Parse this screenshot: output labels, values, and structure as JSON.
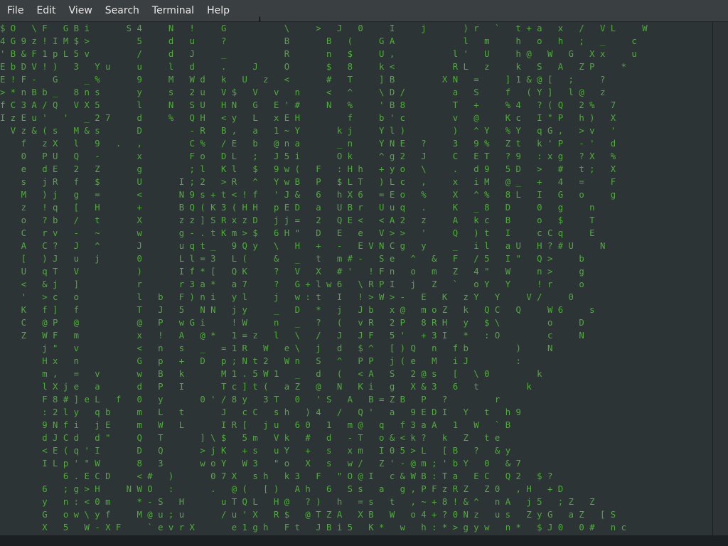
{
  "menubar": {
    "items": [
      "File",
      "Edit",
      "View",
      "Search",
      "Terminal",
      "Help"
    ]
  },
  "terminal": {
    "rows": [
      "$ O   \\ F   G B i       S 4     N   !     G           \\     >   J   0     I     j       ) r   `   t + a   x   /   V L     W",
      "4 G 9 z ! I M $ >         5     d   u     ?           B       B   (     G A             l   m     h   o   h   ;   _     c",
      "' B & F 1 p L 5 v         /     d   J     _           R       n   $     U ,           l '   U     h @   W   G   X x     u",
      "E b D V ! )   3   Y u     u     l   d     .     J     O       $   8     k <           R L   z     k   S   A   Z P     *",
      "E ! F -   G     _ %       9     M   W d   k   U   z   <       #   T     ] B         X N   =     ] 1 & @ [   ;     ?",
      "> * n B b _   8 n s       y     s   2 u   V $   V   v   n     <   ^     \\ D /         a   S     f   ( Y ]   l @   z",
      "f C 3 A / Q   V X 5       l     N   S U   H N   G   E ' #     N   %     ' B 8         T   +     % 4   ? ( Q   2 %   7",
      "I z E u '   '   _ 2 7     d     %   Q H   < y   L   x E H         f     b ' c         v   @     K c   I \" P   h )   X",
      "  V z & ( s   M & s       D         - R   B ,   a   1 ~ Y       k j     Y l )         )   ^ Y   % Y   q G ,   > v   '",
      "    f   z X   l   9   .   ,         C %   / E   b   @ n a       _ n     Y N E   ?     3   9 %   Z t   k ' P   - '   d",
      "    0   P U   Q   -       x         F o   D L   ;   J 5 i       O k     ^ g 2   J     C   E T   ? 9   : x g   ? X   %",
      "    e   d E   2   Z       g         ; l   K l   $   9 w (   F   : H h   + y o   \\     .   d 9   5 D   >   #   t ;   X",
      "    s   j R   f   $       U       I ; 2   > R   ^   Y w B   P   $ L T   ) L c   ,     x   i M   @ _   +   4   =     F",
      "    M   ) j   g   =       <       N 9 s + t < ! f   ' J &   6   h X 6   = E o   %     X   ^ %   8 L   I   G   o     g",
      "    z   ! q   [   H       +       B Q ( K 3 ( H H   p E D   a   U B r   U u q   .     K   _ 8   D     0   g     n",
      "    o   ? b   /   t       X       z z ] S R x z D   j j =   2   Q E <   < A 2   z     A   k c   B     o   $     T",
      "    C   r v   -   ~       w       g - . t K m > $   6 H \"   D   E   e   V > >   '     Q   ) t   I     c C q     E",
      "    A   C ?   J   ^       J       u q t _   9 Q y   \\   H   +   -   E V N C g   y     _   i l   a U   H ? # U     N",
      "    [   ) J   u   j       0       L l = 3   L (     &   _   t   m # -   S e   ^   &   F   / 5   I \"   Q >     b",
      "    U   q T   V           )       I f * [   Q K     ?   V   X   # '   ! F n   o   m   Z   4 \"   W     n >     g",
      "    <   & j   ]           r       r 3 a *   a 7     ?   G + l w 6   \\ R P I   j   Z   `   o Y   Y     ! r     o",
      "    '   > c   o           l   b   F ) n i   y l     j   w : t   I   ! > W > -   E   K   z Y   Y     V /     0",
      "    K   f ]   f           T   J   5   N N   j y     _   D   *   j   J b   x @   m o Z   k   Q C   Q     W 6     s",
      "    C   @ P   @           @   P   w G i     ! W     n   _   ?   (   v R   2 P   8 R H   y   $ \\         o     D",
      "    Z   W F   m           x   !   A   @ *   1 = z   l   \\   /   J   J F   5 '   + 3 I   *   : O         c     N",
      "        j \"   v           <   n   s   _   = 1 R   W   e \\   j   d   $ ^   [ ) Q   n   f b         )     N",
      "        H x   n           G   p   +   D   p ; N t 2   W n   S   ^   P P   j ( e   M   i J         :",
      "        m ,   =   v       w   B   k       M 1 . 5 W 1   _   d   (   < A   S   2 @ s   [   \\ 0         k",
      "        l X j e   a       d   P   I       T c ] t (   a Z   @   N   K i   g   X & 3   6   t         k",
      "        F 8 # ] e L   f   0   y       0 ' / 8 y   3 T   0   ' S   A   B = Z B   P   ?         r",
      "        : 2 l y   q b     m   L   t       J   c C   s h   ) 4   /   Q '   a   9 E D I   Y   t   h 9",
      "        9 N f i   j E     m   W   L       I R [   j u   6 0   1   m @   q   f 3 a A   1   W   ` B",
      "        d J C d   d \"     Q   T       ] \\ $   5 m   V k   #   d   - T   o & < k ?   k   Z   t e",
      "        < E ( q ' I       D   Q       > j K   + s   u Y   +   s   x m   I 0 5 > L   [ B   ?   & y",
      "        I L p ' \" W       8   3       w o Y   W 3   \" o   X   s   w /   Z ' - @ m ; ' b Y   0   & 7",
      "            6 . E C D     < #   )       0 7 X   s h   k 3   F   \" O @ I   c & W B : T a   E C   Q 2   $ ?",
      "        6   ; g > H     N W O   :       .   @ (   [ )   A h   6   S s   a   g , P F z R Z   Z 0   , H   + D",
      "        y   n : < 0 m     * - S   H       u T Q L   H @   ? )   h   = s   t   , ~ + 8 ! & ^   n A   j 5   ; Z   Z",
      "        G   o w \\ y f     M @ u ; u       / u ' X   R $   @ T Z A   X B   W   o 4 + ? 0 N z   u s   Z y G   a Z   [ S",
      "        X   5   W - X F     ` e v r X       e 1 g h   F t   J B i 5   K *   w   h : * > g y w   n *   $ J 0   0 #   n c"
    ]
  }
}
